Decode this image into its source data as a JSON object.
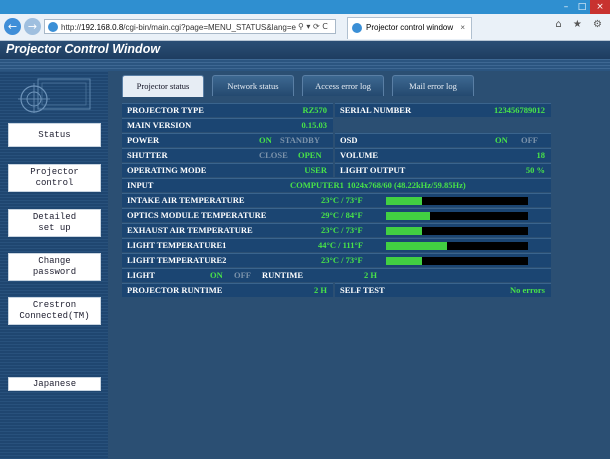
{
  "browser": {
    "url_prefix": "http://",
    "url_host": "192.168.0.8",
    "url_path": "/cgi-bin/main.cgi?page=MENU_STATUS&lang=e",
    "tab_title": "Projector control window",
    "tab_close": "×",
    "addr_tools": "⚲ ▾ ⟳ C",
    "tool_icons": "⌂ ★ ⚙",
    "win_min": "–",
    "win_max": "□",
    "win_close": "×",
    "back": "←",
    "forward": "→"
  },
  "header": {
    "title": "Projector Control Window"
  },
  "sidebar": {
    "buttons": [
      {
        "label": "Status"
      },
      {
        "label": "Projector\ncontrol"
      },
      {
        "label": "Detailed\nset up"
      },
      {
        "label": "Change\npassword"
      },
      {
        "label": "Crestron\nConnected(TM)"
      },
      {
        "label": "Japanese"
      }
    ]
  },
  "tabs": [
    {
      "label": "Projector status"
    },
    {
      "label": "Network status"
    },
    {
      "label": "Access error log"
    },
    {
      "label": "Mail error log"
    }
  ],
  "status": {
    "projector_type": {
      "label": "PROJECTOR TYPE",
      "value": "RZ570"
    },
    "serial_number": {
      "label": "SERIAL NUMBER",
      "value": "123456789012"
    },
    "main_version": {
      "label": "MAIN VERSION",
      "value": "0.15.03"
    },
    "power": {
      "label": "POWER",
      "on": "ON",
      "standby": "STANDBY"
    },
    "osd": {
      "label": "OSD",
      "on": "ON",
      "off": "OFF"
    },
    "shutter": {
      "label": "SHUTTER",
      "close": "CLOSE",
      "open": "OPEN"
    },
    "volume": {
      "label": "VOLUME",
      "value": "18"
    },
    "operating_mode": {
      "label": "OPERATING MODE",
      "value": "USER"
    },
    "light_output": {
      "label": "LIGHT OUTPUT",
      "value": "50 %"
    },
    "input": {
      "label": "INPUT",
      "value": "COMPUTER1",
      "signal": "1024x768/60 (48.22kHz/59.85Hz)"
    },
    "temperatures": [
      {
        "label": "INTAKE AIR TEMPERATURE",
        "value": "23°C / 73°F",
        "level": 0.25
      },
      {
        "label": "OPTICS MODULE TEMPERATURE",
        "value": "29°C / 84°F",
        "level": 0.31
      },
      {
        "label": "EXHAUST AIR TEMPERATURE",
        "value": "23°C / 73°F",
        "level": 0.25
      },
      {
        "label": "LIGHT TEMPERATURE1",
        "value": "44°C / 111°F",
        "level": 0.43
      },
      {
        "label": "LIGHT TEMPERATURE2",
        "value": "23°C / 73°F",
        "level": 0.25
      }
    ],
    "light": {
      "label": "LIGHT",
      "on": "ON",
      "off": "OFF"
    },
    "runtime": {
      "label": "RUNTIME",
      "value": "2 H"
    },
    "projector_runtime": {
      "label": "PROJECTOR RUNTIME",
      "value": "2 H"
    },
    "self_test": {
      "label": "SELF TEST",
      "value": "No errors"
    }
  },
  "colors": {
    "active_value": "#48e348",
    "inactive_value": "#7c93ab",
    "row_bg": "#1b4572",
    "bar_fill": "#42d042"
  }
}
